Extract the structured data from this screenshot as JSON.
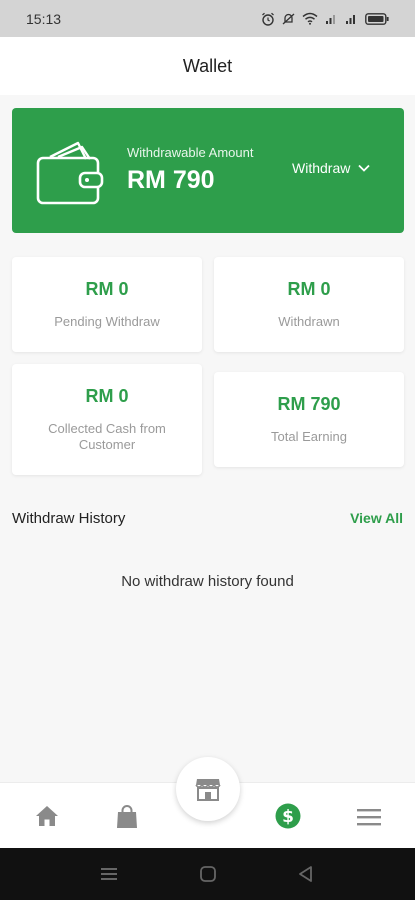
{
  "status_bar": {
    "time": "15:13",
    "icons": [
      "alarm-icon",
      "mute-icon",
      "wifi-icon",
      "signal-icon",
      "signal-icon",
      "battery-icon"
    ]
  },
  "app_bar": {
    "title": "Wallet"
  },
  "balance_card": {
    "label": "Withdrawable Amount",
    "amount": "RM 790",
    "withdraw_label": "Withdraw",
    "icon": "wallet-icon",
    "color": "#2e9e4b"
  },
  "stats": [
    {
      "value": "RM 0",
      "label": "Pending Withdraw"
    },
    {
      "value": "RM 0",
      "label": "Withdrawn"
    },
    {
      "value": "RM 0",
      "label": "Collected Cash from Customer"
    },
    {
      "value": "RM 790",
      "label": "Total Earning"
    }
  ],
  "history": {
    "title": "Withdraw History",
    "view_all": "View All",
    "empty_message": "No withdraw history found"
  },
  "bottom_nav": {
    "items": [
      "home-icon",
      "shopping-bag-icon",
      "store-icon",
      "dollar-icon",
      "menu-icon"
    ],
    "active": "dollar-icon",
    "accent": "#2e9e4b"
  },
  "system_nav": {
    "buttons": [
      "recents-icon",
      "home-circle-icon",
      "back-triangle-icon"
    ]
  }
}
